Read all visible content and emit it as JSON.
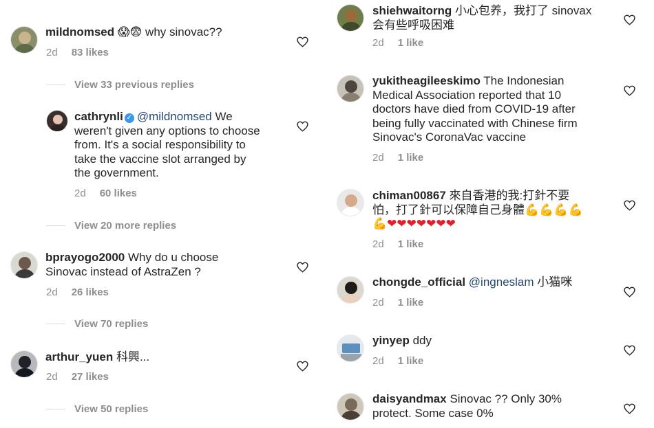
{
  "left_column": {
    "c1": {
      "username": "mildnomsed",
      "emoji": "😱😨",
      "text": "why sinovac??",
      "time": "2d",
      "likes": "83 likes"
    },
    "view1": "View 33 previous replies",
    "c2": {
      "username": "cathrynli",
      "mention": "@mildnomsed",
      "line1_rest": " We",
      "line2": "weren't given any options to choose",
      "line3": "from. It's a social responsibility to",
      "line4": "take the vaccine slot arranged by",
      "line5": "the government.",
      "time": "2d",
      "likes": "60 likes"
    },
    "view2": "View 20 more replies",
    "c3": {
      "username": "bprayogo2000",
      "line1_rest": " Why do u choose",
      "line2": "Sinovac instead of AstraZen ?",
      "time": "2d",
      "likes": "26 likes"
    },
    "view3": "View 70 replies",
    "c4": {
      "username": "arthur_yuen",
      "text": " 科興...",
      "time": "2d",
      "likes": "27 likes"
    },
    "view4": "View 50 replies"
  },
  "right_column": {
    "r1": {
      "username": "shiehwaitorng",
      "line1_rest": " 小心包养，我打了 sinovax",
      "line2": "会有些呼吸困难",
      "time": "2d",
      "likes": "1 like"
    },
    "r2": {
      "username": "yukitheagileeskimo",
      "line1_rest": " The Indonesian",
      "line2": "Medical Association reported that 10",
      "line3": "doctors have died from COVID-19 after",
      "line4": "being fully vaccinated with Chinese firm",
      "line5": "Sinovac's CoronaVac vaccine",
      "time": "2d",
      "likes": "1 like"
    },
    "r3": {
      "username": "chiman00867",
      "line1_rest": " 來自香港的我:打針不要",
      "line2_text": "怕，打了針可以保障自己身體",
      "line2_emoji": "💪💪💪💪",
      "line3_arm": "💪",
      "line3_hearts": "❤❤❤❤❤❤❤",
      "time": "2d",
      "likes": "1 like"
    },
    "r4": {
      "username": "chongde_official",
      "mention": " @ingneslam",
      "rest": " 小猫咪",
      "time": "2d",
      "likes": "1 like"
    },
    "r5": {
      "username": "yinyep",
      "rest": " ddy",
      "time": "2d",
      "likes": "1 like"
    },
    "r6": {
      "username": "daisyandmax",
      "line1_rest": " Sinovac ?? Only 30%",
      "line2": "protect. Some case 0%"
    }
  },
  "colors": {
    "text": "#262626",
    "meta": "#8e8e8e",
    "mention": "#27476f",
    "verified": "#3897f0",
    "divider": "#dbdbdb"
  },
  "icons": {
    "like": "heart-outline-icon",
    "verified": "verified-badge-icon"
  }
}
